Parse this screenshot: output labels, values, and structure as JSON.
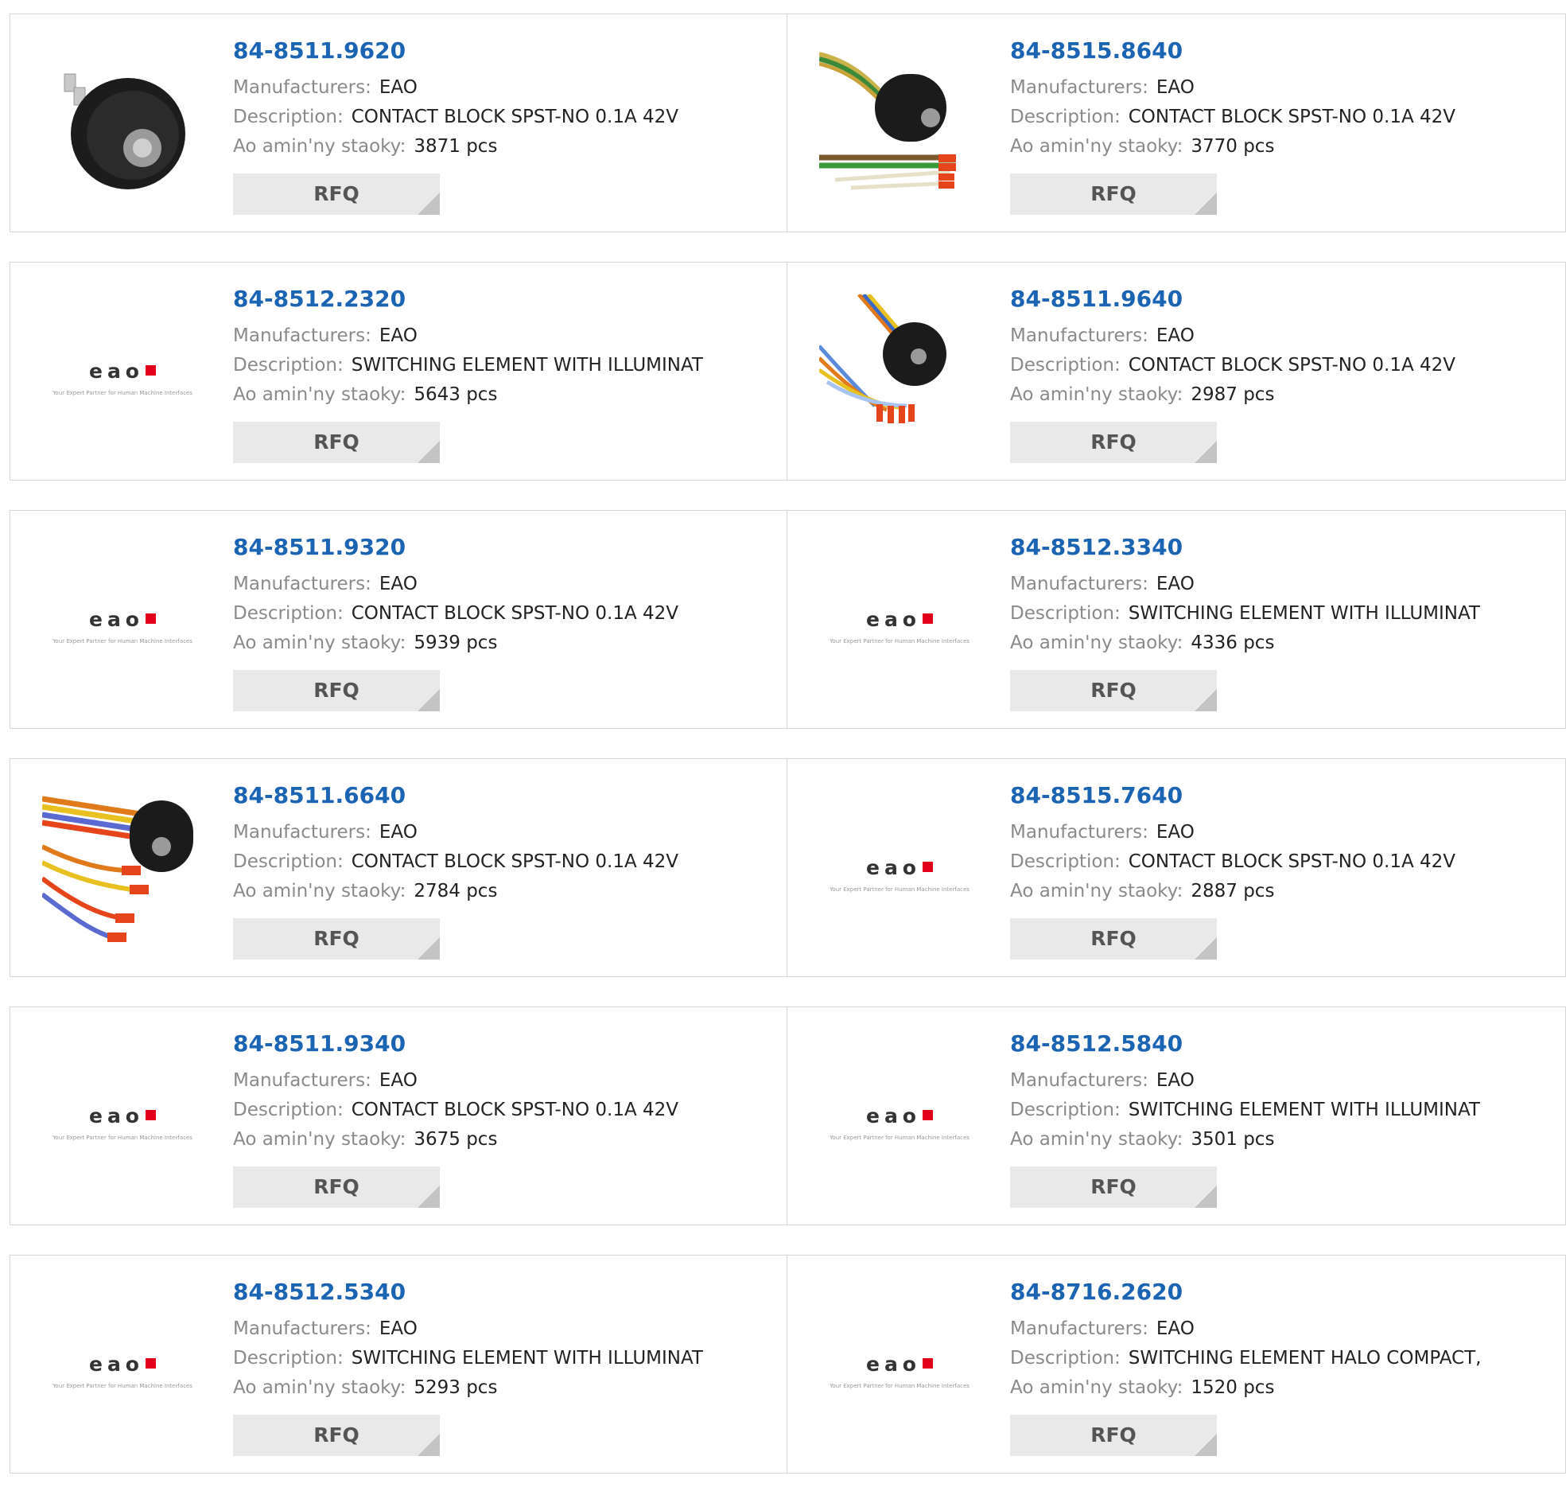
{
  "labels": {
    "manufacturer": "Manufacturers:",
    "description": "Description:",
    "stock": "Ao amin'ny staoky:",
    "rfq": "RFQ",
    "logo_word": "eao",
    "logo_tagline": "Your Expert Partner for Human Machine Interfaces"
  },
  "products": [
    {
      "part": "84-8511.9620",
      "manufacturer": "EAO",
      "description": "CONTACT BLOCK SPST-NO 0.1A 42V",
      "stock": "3871 pcs",
      "image": "contact-block-photo"
    },
    {
      "part": "84-8515.8640",
      "manufacturer": "EAO",
      "description": "CONTACT BLOCK SPST-NO 0.1A 42V",
      "stock": "3770 pcs",
      "image": "contact-block-wires-photo"
    },
    {
      "part": "84-8512.2320",
      "manufacturer": "EAO",
      "description": "SWITCHING ELEMENT WITH ILLUMINAT",
      "stock": "5643 pcs",
      "image": "eao-logo"
    },
    {
      "part": "84-8511.9640",
      "manufacturer": "EAO",
      "description": "CONTACT BLOCK SPST-NO 0.1A 42V",
      "stock": "2987 pcs",
      "image": "contact-block-wires-photo"
    },
    {
      "part": "84-8511.9320",
      "manufacturer": "EAO",
      "description": "CONTACT BLOCK SPST-NO 0.1A 42V",
      "stock": "5939 pcs",
      "image": "eao-logo"
    },
    {
      "part": "84-8512.3340",
      "manufacturer": "EAO",
      "description": "SWITCHING ELEMENT WITH ILLUMINAT",
      "stock": "4336 pcs",
      "image": "eao-logo"
    },
    {
      "part": "84-8511.6640",
      "manufacturer": "EAO",
      "description": "CONTACT BLOCK SPST-NO 0.1A 42V",
      "stock": "2784 pcs",
      "image": "contact-block-wires-photo"
    },
    {
      "part": "84-8515.7640",
      "manufacturer": "EAO",
      "description": "CONTACT BLOCK SPST-NO 0.1A 42V",
      "stock": "2887 pcs",
      "image": "eao-logo"
    },
    {
      "part": "84-8511.9340",
      "manufacturer": "EAO",
      "description": "CONTACT BLOCK SPST-NO 0.1A 42V",
      "stock": "3675 pcs",
      "image": "eao-logo"
    },
    {
      "part": "84-8512.5840",
      "manufacturer": "EAO",
      "description": "SWITCHING ELEMENT WITH ILLUMINAT",
      "stock": "3501 pcs",
      "image": "eao-logo"
    },
    {
      "part": "84-8512.5340",
      "manufacturer": "EAO",
      "description": "SWITCHING ELEMENT WITH ILLUMINAT",
      "stock": "5293 pcs",
      "image": "eao-logo"
    },
    {
      "part": "84-8716.2620",
      "manufacturer": "EAO",
      "description": "SWITCHING ELEMENT HALO COMPACT,",
      "stock": "1520 pcs",
      "image": "eao-logo"
    }
  ]
}
